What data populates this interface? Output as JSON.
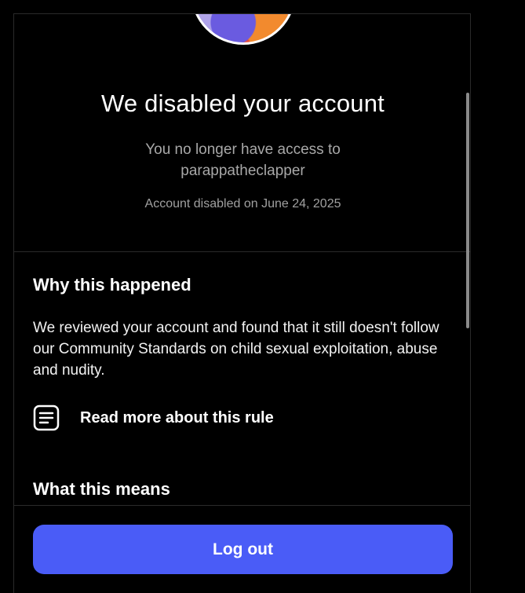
{
  "header": {
    "title": "We disabled your account",
    "subtitle": "You no longer have access to parappatheclapper",
    "disabled_date": "Account disabled on June 24, 2025"
  },
  "why_section": {
    "heading": "Why this happened",
    "body": "We reviewed your account and found that it still doesn't follow our Community Standards on child sexual exploitation, abuse and nudity.",
    "rule_link_label": "Read more about this rule",
    "rule_link_icon": "document-lines-icon"
  },
  "means_section": {
    "heading": "What this means"
  },
  "footer": {
    "logout_label": "Log out"
  },
  "colors": {
    "background": "#000000",
    "accent": "#4a5cf7",
    "text_primary": "#ffffff",
    "text_secondary": "#a8a8a8",
    "divider": "#2a2a2a"
  }
}
